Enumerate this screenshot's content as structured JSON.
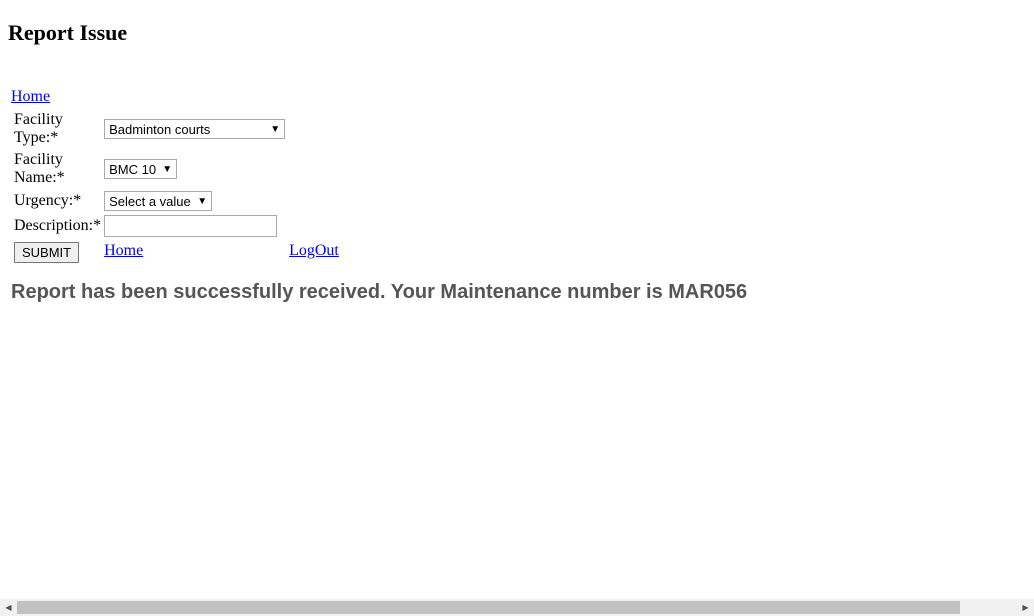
{
  "page": {
    "title": "Report Issue"
  },
  "nav": {
    "home_top": "Home"
  },
  "form": {
    "facility_type": {
      "label_line1": "Facility",
      "label_line2": "Type:*",
      "selected": "Badminton courts"
    },
    "facility_name": {
      "label_line1": "Facility",
      "label_line2": "Name:*",
      "selected": "BMC 10"
    },
    "urgency": {
      "label": "Urgency:*",
      "selected": "Select a value"
    },
    "description": {
      "label": "Description:*",
      "value": ""
    },
    "submit_label": "SUBMIT",
    "home_link": "Home",
    "logout_link": "LogOut"
  },
  "message": {
    "success": "Report has been successfully received. Your Maintenance number is MAR056"
  },
  "icons": {
    "dropdown": "triangle-down",
    "scroll_left": "triangle-left",
    "scroll_right": "triangle-right"
  }
}
